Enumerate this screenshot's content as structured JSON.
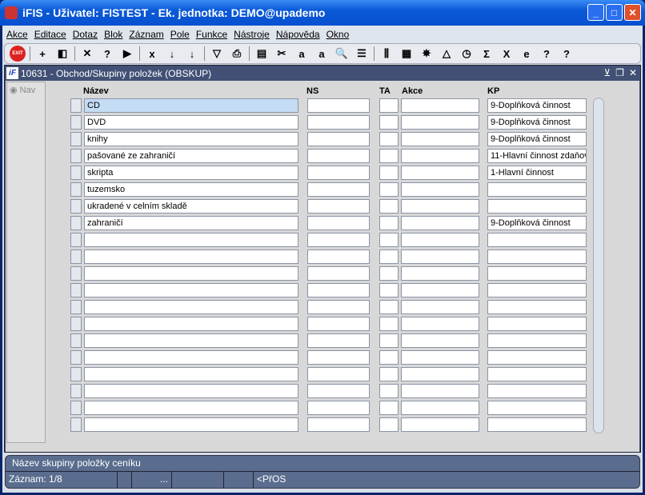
{
  "window": {
    "title": "iFIS - Uživatel: FISTEST - Ek. jednotka: DEMO@upademo"
  },
  "menu": [
    "Akce",
    "Editace",
    "Dotaz",
    "Blok",
    "Záznam",
    "Pole",
    "Funkce",
    "Nástroje",
    "Nápověda",
    "Okno"
  ],
  "toolbar": {
    "exit": "EXIT",
    "icons": [
      "insert-record-icon",
      "save-icon",
      "delete-record-icon",
      "query-enter-icon",
      "query-execute-icon",
      "query-cancel-icon",
      "sort-asc-icon",
      "sort-desc-icon",
      "filter-icon",
      "print-icon",
      "print-preview-icon",
      "cut-icon",
      "copy-icon",
      "paste-icon",
      "search-icon",
      "list-icon",
      "columns-icon",
      "form-icon",
      "tools-icon",
      "warning-icon",
      "clock-icon",
      "sum-icon",
      "excel-icon",
      "browser-icon",
      "help-context-icon",
      "help-icon"
    ]
  },
  "form": {
    "title": "10631 - Obchod/Skupiny položek (OBSKUP)",
    "nav": "Nav",
    "columns": {
      "nazev": "Název",
      "ns": "NS",
      "ta": "TA",
      "akce": "Akce",
      "kp": "KP"
    },
    "rows": [
      {
        "nazev": "CD",
        "kp": "9-Doplňková činnost"
      },
      {
        "nazev": "DVD",
        "kp": "9-Doplňková činnost"
      },
      {
        "nazev": "knihy",
        "kp": "9-Doplňková činnost"
      },
      {
        "nazev": "pašované ze zahraničí",
        "kp": "11-Hlavní činnost zdaňov"
      },
      {
        "nazev": "skripta",
        "kp": "1-Hlavní činnost"
      },
      {
        "nazev": "tuzemsko",
        "kp": ""
      },
      {
        "nazev": "ukradené v celním skladě",
        "kp": ""
      },
      {
        "nazev": "zahraničí",
        "kp": "9-Doplňková činnost"
      }
    ],
    "total_rows": 20
  },
  "status": {
    "hint": "Název skupiny položky ceníku",
    "record": "Záznam: 1/8",
    "dots": "...",
    "mode": "<PřOS"
  }
}
